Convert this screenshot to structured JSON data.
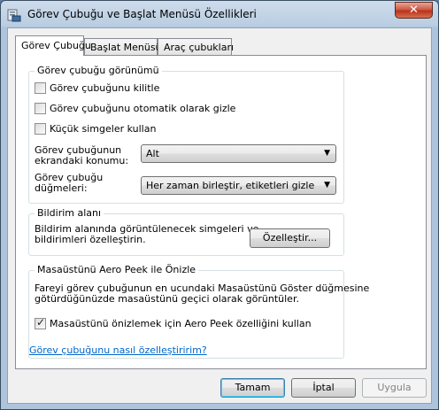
{
  "window": {
    "title": "Görev Çubuğu ve Başlat Menüsü Özellikleri",
    "close_glyph": "✕"
  },
  "tabs": [
    {
      "label": "Görev Çubuğu",
      "active": true
    },
    {
      "label": "Başlat Menüsü",
      "active": false
    },
    {
      "label": "Araç çubukları",
      "active": false
    }
  ],
  "appearance": {
    "title": "Görev çubuğu görünümü",
    "lock_label": "Görev çubuğunu kilitle",
    "lock_checked": false,
    "autohide_label": "Görev çubuğunu otomatik olarak gizle",
    "autohide_checked": false,
    "small_icons_label": "Küçük simgeler kullan",
    "small_icons_checked": false,
    "location_label_1": "Görev çubuğunun",
    "location_label_2": "ekrandaki konumu:",
    "location_value": "Alt",
    "buttons_label_1": "Görev çubuğu",
    "buttons_label_2": "düğmeleri:",
    "buttons_value": "Her zaman birleştir, etiketleri gizle"
  },
  "notification": {
    "title": "Bildirim alanı",
    "text_1": "Bildirim alanında görüntülenecek simgeleri ve",
    "text_2": "bildirimleri özelleştirin.",
    "customize_label": "Özelleştir..."
  },
  "aero_peek": {
    "title": "Masaüstünü Aero Peek ile Önizle",
    "text_1": "Fareyi görev çubuğunun en ucundaki Masaüstünü Göster düğmesine",
    "text_2": "götürdüğünüzde masaüstünü geçici olarak görüntüler.",
    "checkbox_label": "Masaüstünü önizlemek için Aero Peek özelliğini kullan",
    "checkbox_checked": true
  },
  "help_link": "Görev çubuğunu nasıl özelleştiririm?",
  "footer": {
    "ok_label": "Tamam",
    "cancel_label": "İptal",
    "apply_label": "Uygula"
  }
}
